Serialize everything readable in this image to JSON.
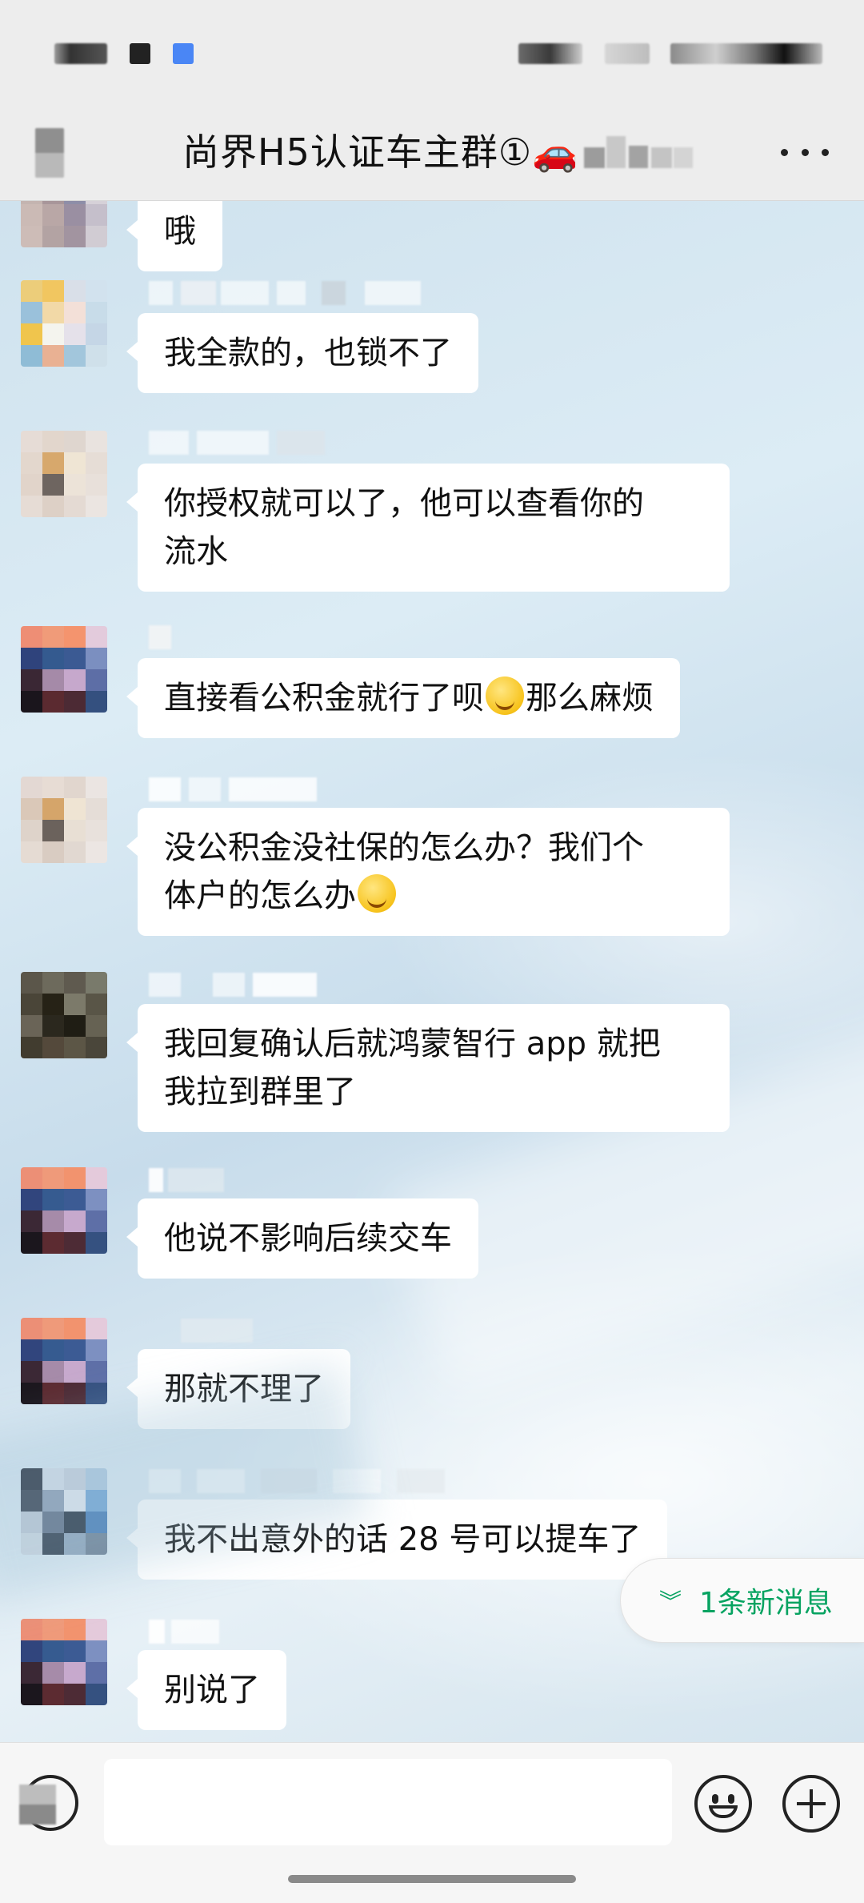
{
  "header": {
    "title": "尚界H5认证车主群①🚗"
  },
  "messages": [
    {
      "text": "哦"
    },
    {
      "text": "我全款的，也锁不了"
    },
    {
      "text": "你授权就可以了，他可以查看你的\n流水"
    },
    {
      "text_before": "直接看公积金就行了呗",
      "emoji": "flushed-face-icon",
      "text_after": "那么麻烦"
    },
    {
      "text_before": "没公积金没社保的怎么办？我们个\n体户的怎么办",
      "emoji": "loudly-crying-face-icon",
      "text_after": ""
    },
    {
      "text": "我回复确认后就鸿蒙智行 app 就把\n我拉到群里了"
    },
    {
      "text": "他说不影响后续交车"
    },
    {
      "text": "那就不理了"
    },
    {
      "text": "我不出意外的话 28 号可以提车了"
    },
    {
      "text": "别说了"
    }
  ],
  "new_message_pill": {
    "label": "1条新消息",
    "color": "#07a361"
  },
  "colors": {
    "accent": "#07a361",
    "bubble": "#ffffff",
    "header_bg": "#ededed"
  }
}
